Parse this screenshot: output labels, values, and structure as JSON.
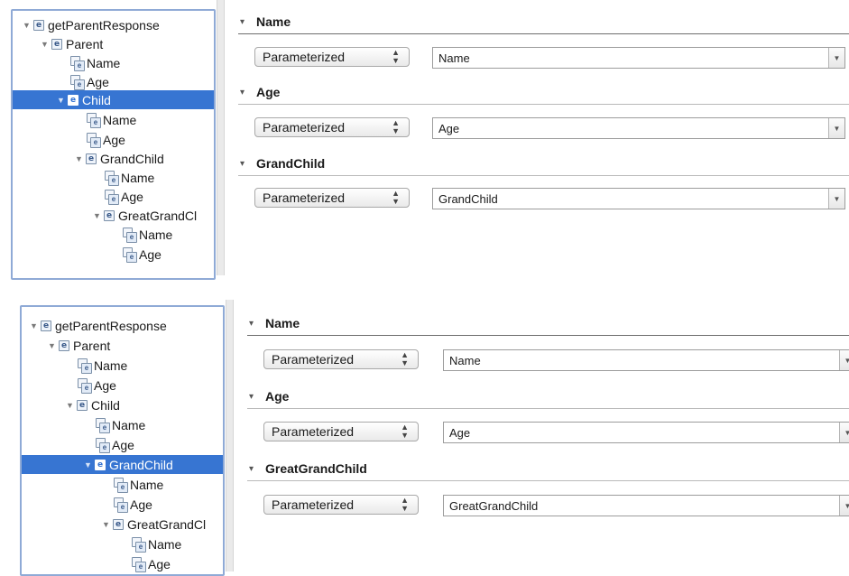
{
  "panels": [
    {
      "tree": [
        {
          "label": "getParentResponse",
          "type": "element",
          "expanded": true,
          "selected": false
        },
        {
          "label": "Parent",
          "type": "element",
          "expanded": true,
          "selected": false
        },
        {
          "label": "Name",
          "type": "attribute",
          "selected": false
        },
        {
          "label": "Age",
          "type": "attribute",
          "selected": false
        },
        {
          "label": "Child",
          "type": "element",
          "expanded": true,
          "selected": true
        },
        {
          "label": "Name",
          "type": "attribute",
          "selected": false
        },
        {
          "label": "Age",
          "type": "attribute",
          "selected": false
        },
        {
          "label": "GrandChild",
          "type": "element",
          "expanded": true,
          "selected": false
        },
        {
          "label": "Name",
          "type": "attribute",
          "selected": false
        },
        {
          "label": "Age",
          "type": "attribute",
          "selected": false
        },
        {
          "label": "GreatGrandCl",
          "type": "element",
          "expanded": true,
          "selected": false
        },
        {
          "label": "Name",
          "type": "attribute",
          "selected": false
        },
        {
          "label": "Age",
          "type": "attribute",
          "selected": false
        }
      ],
      "sections": [
        {
          "title": "Name",
          "mode": "Parameterized",
          "value": "Name"
        },
        {
          "title": "Age",
          "mode": "Parameterized",
          "value": "Age"
        },
        {
          "title": "GrandChild",
          "mode": "Parameterized",
          "value": "GrandChild"
        }
      ]
    },
    {
      "tree": [
        {
          "label": "getParentResponse",
          "type": "element",
          "expanded": true,
          "selected": false
        },
        {
          "label": "Parent",
          "type": "element",
          "expanded": true,
          "selected": false
        },
        {
          "label": "Name",
          "type": "attribute",
          "selected": false
        },
        {
          "label": "Age",
          "type": "attribute",
          "selected": false
        },
        {
          "label": "Child",
          "type": "element",
          "expanded": true,
          "selected": false
        },
        {
          "label": "Name",
          "type": "attribute",
          "selected": false
        },
        {
          "label": "Age",
          "type": "attribute",
          "selected": false
        },
        {
          "label": "GrandChild",
          "type": "element",
          "expanded": true,
          "selected": true
        },
        {
          "label": "Name",
          "type": "attribute",
          "selected": false
        },
        {
          "label": "Age",
          "type": "attribute",
          "selected": false
        },
        {
          "label": "GreatGrandCl",
          "type": "element",
          "expanded": true,
          "selected": false
        },
        {
          "label": "Name",
          "type": "attribute",
          "selected": false
        },
        {
          "label": "Age",
          "type": "attribute",
          "selected": false
        }
      ],
      "sections": [
        {
          "title": "Name",
          "mode": "Parameterized",
          "value": "Name"
        },
        {
          "title": "Age",
          "mode": "Parameterized",
          "value": "Age"
        },
        {
          "title": "GreatGrandChild",
          "mode": "Parameterized",
          "value": "GreatGrandChild"
        }
      ]
    }
  ],
  "icons": {
    "element": "element-icon",
    "attribute": "attribute-icon",
    "expanded": "disclosure-triangle-icon",
    "section": "collapse-chevron-icon",
    "select": "select-stepper-icon",
    "combo": "dropdown-arrow-icon"
  },
  "colors": {
    "selection": "#3775d2",
    "tree_border": "#8faad6"
  }
}
